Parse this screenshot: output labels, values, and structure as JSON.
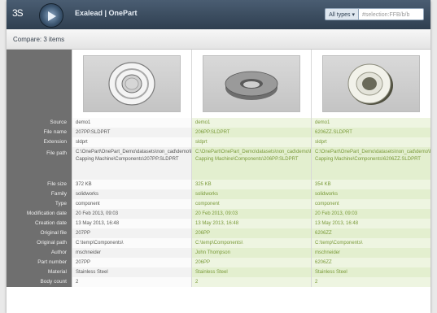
{
  "header": {
    "logo_text": "3S",
    "app_title": "Exalead | OnePart",
    "type_selector": "All types ▾",
    "search_value": "#selection:FFB/b/b"
  },
  "compare": {
    "title": "Compare: 3 items"
  },
  "rows": [
    {
      "label": "Source",
      "values": [
        "demo1",
        "demo1",
        "demo1"
      ]
    },
    {
      "label": "File name",
      "values": [
        "207PP.SLDPRT",
        "206PP.SLDPRT",
        "6206ZZ.SLDPRT"
      ]
    },
    {
      "label": "Extension",
      "values": [
        "sldprt",
        "sldprt",
        "sldprt"
      ]
    },
    {
      "label": "File path",
      "values": [
        "C:\\OnePart\\OnePart_Demo\\datasets\\non_cad\\demo\\FFB\\smaller Capping Machine\\Components\\207PP.SLDPRT",
        "C:\\OnePart\\OnePart_Demo\\datasets\\non_cad\\demo\\FFB\\smaller Capping Machine\\Components\\206PP.SLDPRT",
        "C:\\OnePart\\OnePart_Demo\\datasets\\non_cad\\demo\\FFB\\smaller Capping Machine\\Components\\6206ZZ.SLDPRT"
      ]
    },
    {
      "label": "File size",
      "values": [
        "372 KB",
        "325 KB",
        "354 KB"
      ]
    },
    {
      "label": "Family",
      "values": [
        "solidworks",
        "solidworks",
        "solidworks"
      ]
    },
    {
      "label": "Type",
      "values": [
        "component",
        "component",
        "component"
      ]
    },
    {
      "label": "Modification date",
      "values": [
        "20 Feb 2013, 09:03",
        "20 Feb 2013, 09:03",
        "20 Feb 2013, 09:03"
      ]
    },
    {
      "label": "Creation date",
      "values": [
        "13 May 2013, 16:48",
        "13 May 2013, 16:48",
        "13 May 2013, 16:48"
      ]
    },
    {
      "label": "Original file",
      "values": [
        "207PP",
        "206PP",
        "6206ZZ"
      ]
    },
    {
      "label": "Original path",
      "values": [
        "C:\\temp\\Components\\",
        "C:\\temp\\Components\\",
        "C:\\temp\\Components\\"
      ]
    },
    {
      "label": "Author",
      "values": [
        "mschneider",
        "John Thompson",
        "mschneider"
      ]
    },
    {
      "label": "Part number",
      "values": [
        "207PP",
        "206PP",
        "6206ZZ"
      ]
    },
    {
      "label": "Material",
      "values": [
        "Stainless Steel",
        "Stainless Steel",
        "Stainless Steel"
      ]
    },
    {
      "label": "Body count",
      "values": [
        "2",
        "2",
        "2"
      ]
    }
  ]
}
